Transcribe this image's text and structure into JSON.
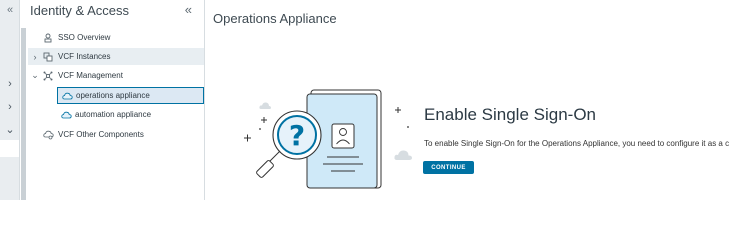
{
  "rail": {
    "collapse_glyph": "«",
    "chevron_glyph": "›",
    "chevron_down_glyph": "⌄"
  },
  "nav": {
    "title": "Identity & Access",
    "collapse_glyph": "«",
    "items": [
      {
        "label": "SSO Overview",
        "icon": "sso-overview-icon"
      },
      {
        "label": "VCF Instances",
        "icon": "vcf-instances-icon",
        "chevron": "›"
      },
      {
        "label": "VCF Management",
        "icon": "vcf-management-icon",
        "chevron": "⌄"
      },
      {
        "label": "VCF Other Components",
        "icon": "vcf-other-components-icon"
      }
    ],
    "sub_items": [
      {
        "label": "operations appliance",
        "icon": "cloud-icon"
      },
      {
        "label": "automation appliance",
        "icon": "cloud-icon"
      }
    ]
  },
  "main": {
    "title": "Operations Appliance",
    "empty_state": {
      "title": "Enable Single Sign-On",
      "description": "To enable Single Sign-On for the Operations Appliance, you need to configure it as a c",
      "button": "CONTINUE"
    }
  },
  "colors": {
    "accent": "#0072a3",
    "nav_selected_bg": "#dce8f3",
    "rail_bg": "#e9edf0"
  }
}
